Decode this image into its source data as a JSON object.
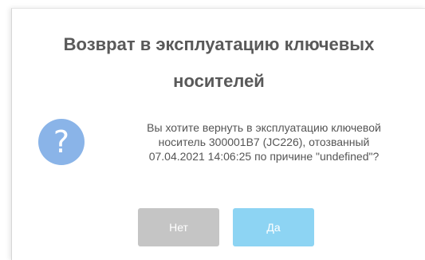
{
  "dialog": {
    "title": "Возврат в эксплуатацию ключевых\nносителей",
    "icon": "question-icon",
    "icon_color": "#8ab4e8",
    "message": "Вы хотите вернуть в эксплуатацию ключевой\nноситель 300001B7 (JC226), отозванный\n07.04.2021 14:06:25 по причине \"undefined\"?",
    "buttons": {
      "no_label": "Нет",
      "yes_label": "Да"
    }
  },
  "colors": {
    "no_button": "#c5c5c5",
    "yes_button": "#8dd4f3",
    "title_text": "#595959"
  }
}
